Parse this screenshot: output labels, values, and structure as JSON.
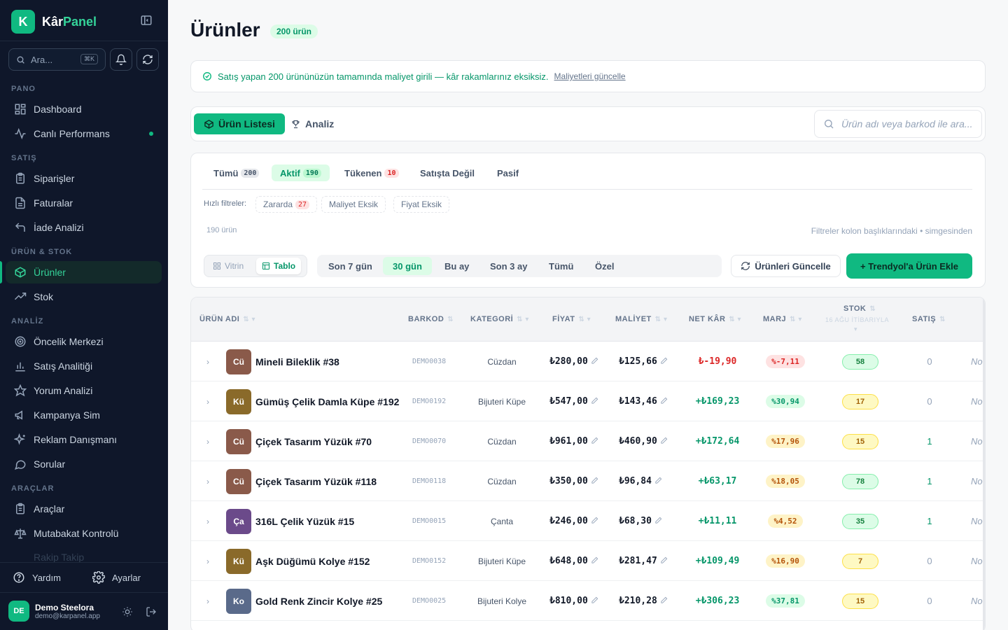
{
  "brand": {
    "logo_letter": "K",
    "name_part1": "Kâr",
    "name_part2": "Panel"
  },
  "search": {
    "placeholder": "Ara...",
    "shortcut": "⌘K"
  },
  "sidebar": {
    "sections": [
      {
        "title": "PANO",
        "items": [
          {
            "label": "Dashboard",
            "icon": "dashboard-icon"
          },
          {
            "label": "Canlı Performans",
            "icon": "activity-icon",
            "live": true
          }
        ]
      },
      {
        "title": "SATIŞ",
        "items": [
          {
            "label": "Siparişler",
            "icon": "clipboard-icon"
          },
          {
            "label": "Faturalar",
            "icon": "document-icon"
          },
          {
            "label": "İade Analizi",
            "icon": "undo-icon"
          }
        ]
      },
      {
        "title": "ÜRÜN & STOK",
        "items": [
          {
            "label": "Ürünler",
            "icon": "box-icon",
            "active": true
          },
          {
            "label": "Stok",
            "icon": "trend-icon"
          }
        ]
      },
      {
        "title": "ANALİZ",
        "items": [
          {
            "label": "Öncelik Merkezi",
            "icon": "target-icon"
          },
          {
            "label": "Satış Analitiği",
            "icon": "bar-chart-icon"
          },
          {
            "label": "Yorum Analizi",
            "icon": "star-icon"
          },
          {
            "label": "Kampanya Sim",
            "icon": "megaphone-icon"
          },
          {
            "label": "Reklam Danışmanı",
            "icon": "sparkles-icon"
          },
          {
            "label": "Sorular",
            "icon": "chat-icon"
          }
        ]
      },
      {
        "title": "ARAÇLAR",
        "items": [
          {
            "label": "Araçlar",
            "icon": "clipboard-icon"
          },
          {
            "label": "Mutabakat Kontrolü",
            "icon": "scale-icon"
          }
        ]
      }
    ],
    "faded_item": "Rakip Takip",
    "help": "Yardım",
    "settings": "Ayarlar",
    "user": {
      "initials": "DE",
      "name": "Demo Steelora",
      "email": "demo@karpanel.app"
    }
  },
  "page": {
    "title": "Ürünler",
    "count_badge": "200 ürün"
  },
  "alert": {
    "text": "Satış yapan 200 ürününüzün tamamında maliyet girili — kâr rakamlarınız eksiksiz.",
    "link": "Maliyetleri güncelle"
  },
  "toolbar": {
    "tab_list": "Ürün Listesi",
    "tab_analysis": "Analiz",
    "search_placeholder": "Ürün adı veya barkod ile ara..."
  },
  "status_tabs": [
    {
      "label": "Tümü",
      "count": "200"
    },
    {
      "label": "Aktif",
      "count": "190",
      "active": true
    },
    {
      "label": "Tükenen",
      "count": "10",
      "red": true
    },
    {
      "label": "Satışta Değil",
      "count": ""
    },
    {
      "label": "Pasif",
      "count": ""
    }
  ],
  "quick_filters": {
    "label": "Hızlı filtreler:",
    "chips": [
      {
        "label": "Zararda",
        "count": "27"
      },
      {
        "label": "Maliyet Eksik",
        "count": ""
      },
      {
        "label": "Fiyat Eksik",
        "count": ""
      }
    ]
  },
  "info": {
    "count": "190 ürün",
    "hint": "Filtreler kolon başlıklarındaki • simgesinden"
  },
  "view_toggle": {
    "vitrin": "Vitrin",
    "tablo": "Tablo"
  },
  "periods": [
    {
      "label": "Son 7 gün"
    },
    {
      "label": "30 gün",
      "active": true
    },
    {
      "label": "Bu ay"
    },
    {
      "label": "Son 3 ay"
    },
    {
      "label": "Tümü"
    },
    {
      "label": "Özel"
    }
  ],
  "actions": {
    "update": "Ürünleri Güncelle",
    "add": "+ Trendyol'a Ürün Ekle"
  },
  "table": {
    "columns": {
      "name": "ÜRÜN ADI",
      "barcode": "BARKOD",
      "category": "KATEGORİ",
      "price": "FİYAT",
      "cost": "MALİYET",
      "profit": "NET KÂR",
      "margin": "MARJ",
      "stock": "STOK",
      "stock_sub": "16 AĞU İTİBARIYLA",
      "sales": "SATIŞ",
      "note": "I"
    },
    "rows": [
      {
        "abbr": "Cü",
        "thumb_color": "#8a5a4a",
        "name": "Mineli Bileklik #38",
        "barcode": "DEMO0038",
        "category": "Cüzdan",
        "price": "₺280,00",
        "cost": "₺125,66",
        "profit": "₺-19,90",
        "profit_color": "#dc2626",
        "margin": "%-7,11",
        "margin_bg": "#fee2e2",
        "margin_color": "#dc2626",
        "stock": "58",
        "stock_bg": "#dcfce7",
        "stock_border": "#86efac",
        "stock_color": "#15803d",
        "sales": "0",
        "sales_color": "#94a3b8",
        "note": "Not"
      },
      {
        "abbr": "Kü",
        "thumb_color": "#8a6a2a",
        "name": "Gümüş Çelik Damla Küpe #192",
        "barcode": "DEMO0192",
        "category": "Bijuteri Küpe",
        "price": "₺547,00",
        "cost": "₺143,46",
        "profit": "+₺169,23",
        "profit_color": "#059669",
        "margin": "%30,94",
        "margin_bg": "#dcfce7",
        "margin_color": "#059669",
        "stock": "17",
        "stock_bg": "#fef9c3",
        "stock_border": "#fde047",
        "stock_color": "#a16207",
        "sales": "0",
        "sales_color": "#94a3b8",
        "note": "Not"
      },
      {
        "abbr": "Cü",
        "thumb_color": "#8a5a4a",
        "name": "Çiçek Tasarım Yüzük #70",
        "barcode": "DEMO0070",
        "category": "Cüzdan",
        "price": "₺961,00",
        "cost": "₺460,90",
        "profit": "+₺172,64",
        "profit_color": "#059669",
        "margin": "%17,96",
        "margin_bg": "#fef3c7",
        "margin_color": "#b45309",
        "stock": "15",
        "stock_bg": "#fef9c3",
        "stock_border": "#fde047",
        "stock_color": "#a16207",
        "sales": "1",
        "sales_color": "#059669",
        "note": "Not"
      },
      {
        "abbr": "Cü",
        "thumb_color": "#8a5a4a",
        "name": "Çiçek Tasarım Yüzük #118",
        "barcode": "DEMO0118",
        "category": "Cüzdan",
        "price": "₺350,00",
        "cost": "₺96,84",
        "profit": "+₺63,17",
        "profit_color": "#059669",
        "margin": "%18,05",
        "margin_bg": "#fef3c7",
        "margin_color": "#b45309",
        "stock": "78",
        "stock_bg": "#dcfce7",
        "stock_border": "#86efac",
        "stock_color": "#15803d",
        "sales": "1",
        "sales_color": "#059669",
        "note": "Not"
      },
      {
        "abbr": "Ça",
        "thumb_color": "#6b4a8a",
        "name": "316L Çelik Yüzük #15",
        "barcode": "DEMO0015",
        "category": "Çanta",
        "price": "₺246,00",
        "cost": "₺68,30",
        "profit": "+₺11,11",
        "profit_color": "#059669",
        "margin": "%4,52",
        "margin_bg": "#fef3c7",
        "margin_color": "#b45309",
        "stock": "35",
        "stock_bg": "#dcfce7",
        "stock_border": "#86efac",
        "stock_color": "#15803d",
        "sales": "1",
        "sales_color": "#059669",
        "note": "Not"
      },
      {
        "abbr": "Kü",
        "thumb_color": "#8a6a2a",
        "name": "Aşk Düğümü Kolye #152",
        "barcode": "DEMO0152",
        "category": "Bijuteri Küpe",
        "price": "₺648,00",
        "cost": "₺281,47",
        "profit": "+₺109,49",
        "profit_color": "#059669",
        "margin": "%16,90",
        "margin_bg": "#fef3c7",
        "margin_color": "#b45309",
        "stock": "7",
        "stock_bg": "#fef9c3",
        "stock_border": "#fde047",
        "stock_color": "#a16207",
        "sales": "0",
        "sales_color": "#94a3b8",
        "note": "Not"
      },
      {
        "abbr": "Ko",
        "thumb_color": "#5a6a8a",
        "name": "Gold Renk Zincir Kolye #25",
        "barcode": "DEMO0025",
        "category": "Bijuteri Kolye",
        "price": "₺810,00",
        "cost": "₺210,28",
        "profit": "+₺306,23",
        "profit_color": "#059669",
        "margin": "%37,81",
        "margin_bg": "#dcfce7",
        "margin_color": "#059669",
        "stock": "15",
        "stock_bg": "#fef9c3",
        "stock_border": "#fde047",
        "stock_color": "#a16207",
        "sales": "0",
        "sales_color": "#94a3b8",
        "note": "Not"
      }
    ]
  },
  "colors": {
    "accent": "#10b981",
    "sidebar_bg": "#0f172a",
    "danger": "#dc2626"
  }
}
